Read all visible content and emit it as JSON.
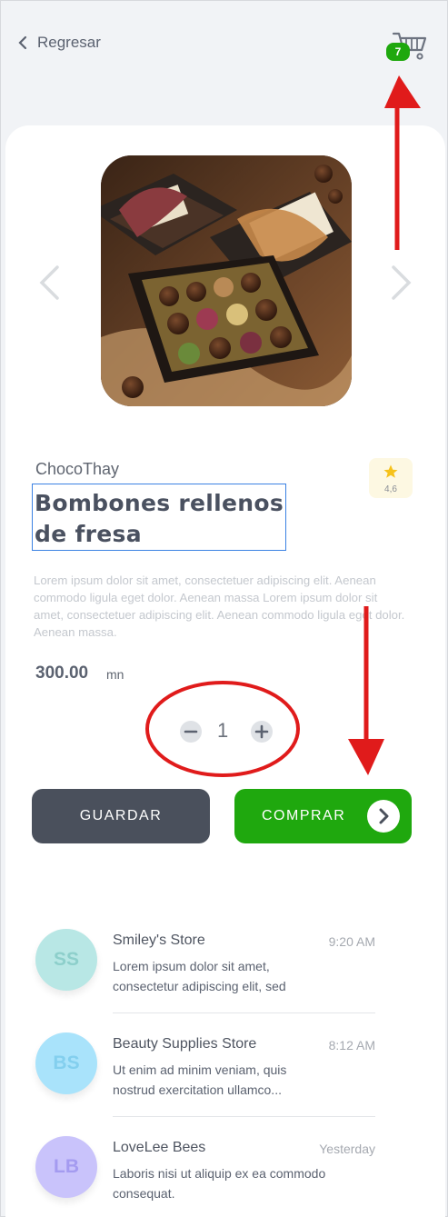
{
  "header": {
    "back_label": "Regresar",
    "cart_count": "7"
  },
  "product": {
    "brand": "ChocoThay",
    "name_line1": "Bombones rellenos",
    "name_line2": "de fresa",
    "rating": "4,6",
    "description": "Lorem ipsum dolor sit amet, consectetuer adipiscing elit. Aenean commodo ligula eget dolor. Aenean massa Lorem ipsum dolor sit amet, consectetuer adipiscing elit. Aenean commodo ligula eget dolor. Aenean massa.",
    "price": "300.00",
    "currency": "mn",
    "quantity": "1"
  },
  "actions": {
    "save_label": "GUARDAR",
    "buy_label": "COMPRAR"
  },
  "conversations": [
    {
      "initials": "SS",
      "name": "Smiley's Store",
      "time": "9:20 AM",
      "message": "Lorem ipsum dolor sit amet, consectetur adipiscing elit, sed"
    },
    {
      "initials": "BS",
      "name": "Beauty Supplies Store",
      "time": "8:12 AM",
      "message": "Ut enim ad minim veniam, quis nostrud exercitation ullamco..."
    },
    {
      "initials": "LB",
      "name": "LoveLee Bees",
      "time": "Yesterday",
      "message": "Laboris nisi ut aliquip ex ea commodo consequat."
    }
  ],
  "colors": {
    "accent_green": "#1fa80e",
    "dark_button": "#4a505c",
    "annotation_red": "#e01b1b",
    "avatar_ss": "#b8e7e5",
    "avatar_bs": "#a9e3fb",
    "avatar_lb": "#c9c3fb"
  },
  "icons": [
    "chevron-left-icon",
    "cart-icon",
    "chevron-right-icon",
    "star-icon",
    "minus-icon",
    "plus-icon"
  ]
}
